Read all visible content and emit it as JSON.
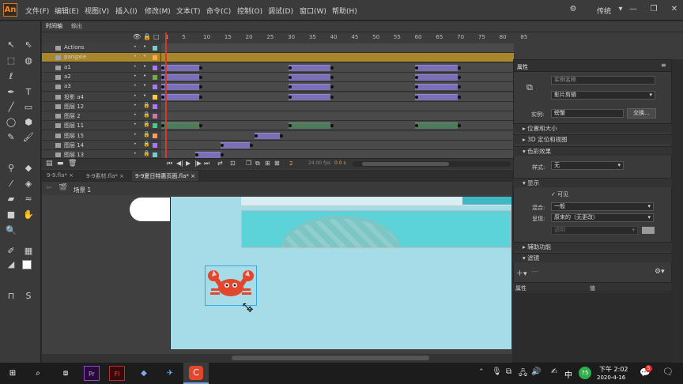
{
  "app": {
    "logo": "An"
  },
  "menu": [
    "文件(F)",
    "编辑(E)",
    "视图(V)",
    "插入(I)",
    "修改(M)",
    "文本(T)",
    "命令(C)",
    "控制(O)",
    "调试(D)",
    "窗口(W)",
    "帮助(H)"
  ],
  "workspace": "传统",
  "timeline": {
    "tabs": [
      "时间轴",
      "输出"
    ],
    "frame_numbers": [
      "1",
      "5",
      "10",
      "15",
      "20",
      "25",
      "30",
      "35",
      "40",
      "45",
      "50",
      "55",
      "60",
      "65",
      "70",
      "75",
      "80",
      "85"
    ],
    "layers": [
      "Actions",
      "pangxie",
      "a1",
      "a2",
      "a3",
      "投影 a4",
      "图层 12",
      "图层 2",
      "图层 11",
      "图层 15",
      "图层 14",
      "图层 13"
    ],
    "current_frame": "2",
    "fps": "24.00 fps",
    "time": "0.0 s"
  },
  "doc_tabs": [
    "9-9.fla*",
    "9-9素材.fla*",
    "9-9夏日特惠页面.fla*"
  ],
  "breadcrumb": "场景 1",
  "properties": {
    "title": "属性",
    "instance_name_placeholder": "实例名称",
    "symbol_type": "影片剪辑",
    "instance_label": "实例:",
    "instance_value": "螃蟹",
    "swap_button": "交换...",
    "sections": {
      "position": "位置和大小",
      "3d": "3D 定位和视图",
      "color": "色彩效果",
      "display": "显示",
      "accessibility": "辅助功能",
      "filters": "滤镜"
    },
    "style_label": "样式:",
    "style_value": "无",
    "visible_label": "可见",
    "blend_label": "混合:",
    "blend_value": "一般",
    "render_label": "呈现:",
    "render_value": "原来的（无更改）",
    "transparent_value": "透明",
    "filter_col_prop": "属性",
    "filter_col_value": "值"
  },
  "taskbar": {
    "ime": "中",
    "badge": "75",
    "time": "下午 2:02",
    "date": "2020-4-16",
    "notifications": "5"
  },
  "colors": {
    "accent_orange": "#e88b35",
    "selected_layer": "#a8862b",
    "stage_bg": "#a6dbe8",
    "tween": "#7b6fb8",
    "playhead": "#d83a2a"
  }
}
